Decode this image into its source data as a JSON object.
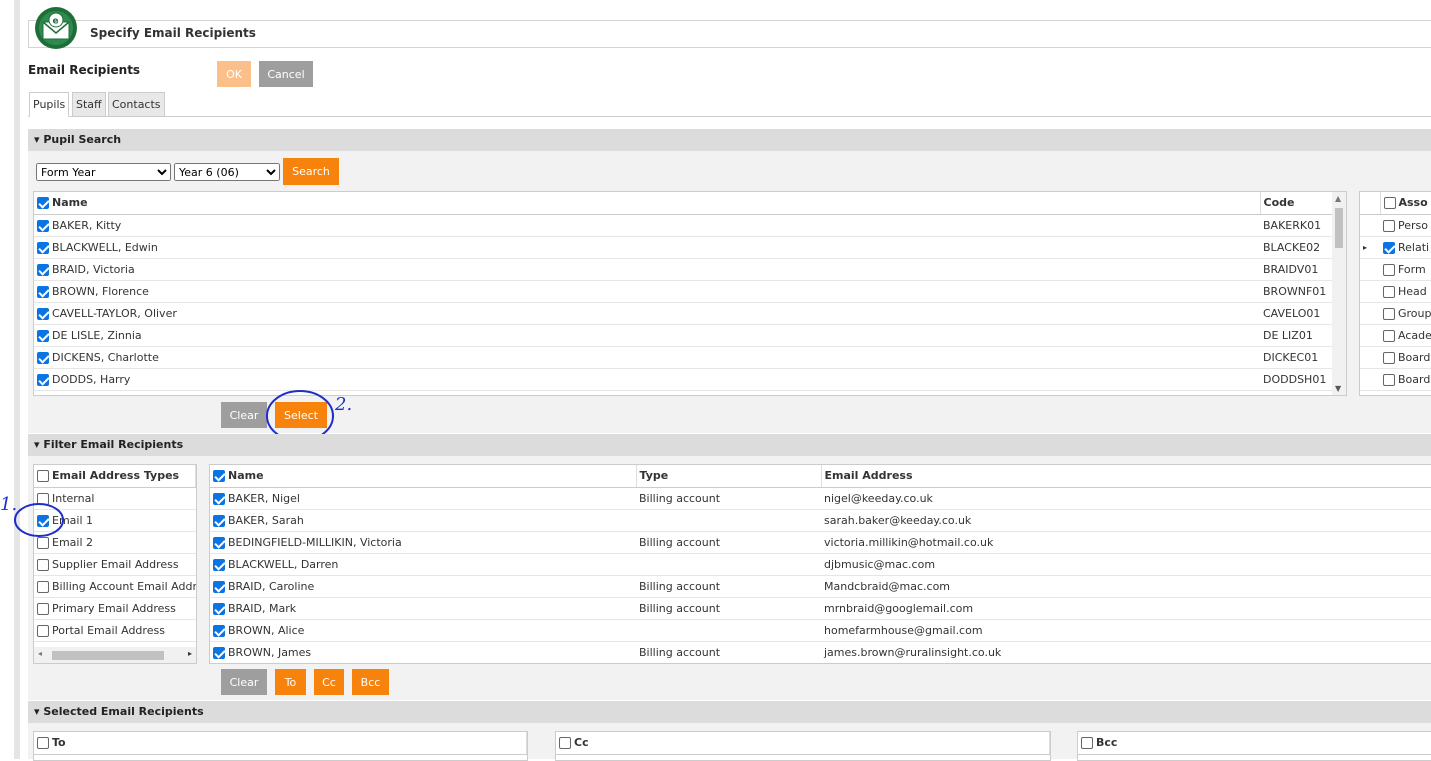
{
  "header": {
    "title": "Specify Email Recipients"
  },
  "recipients": {
    "heading": "Email Recipients",
    "ok_label": "OK",
    "cancel_label": "Cancel",
    "tabs": [
      "Pupils",
      "Staff",
      "Contacts"
    ]
  },
  "pupil_search": {
    "title": "Pupil Search",
    "filter_type": "Form Year",
    "filter_value": "Year 6 (06)",
    "search_label": "Search",
    "columns": {
      "name": "Name",
      "code": "Code"
    },
    "rows": [
      {
        "name": "BAKER, Kitty",
        "code": "BAKERK01"
      },
      {
        "name": "BLACKWELL, Edwin",
        "code": "BLACKE02"
      },
      {
        "name": "BRAID, Victoria",
        "code": "BRAIDV01"
      },
      {
        "name": "BROWN, Florence",
        "code": "BROWNF01"
      },
      {
        "name": "CAVELL-TAYLOR, Oliver",
        "code": "CAVELO01"
      },
      {
        "name": "DE LISLE, Zinnia",
        "code": "DE LIZ01"
      },
      {
        "name": "DICKENS, Charlotte",
        "code": "DICKEC01"
      },
      {
        "name": "DODDS, Harry",
        "code": "DODDSH01"
      }
    ],
    "assoc_header": "Asso",
    "assoc_rows": [
      "Perso",
      "Relati",
      "Form",
      "Head",
      "Group",
      "Acade",
      "Board",
      "Board"
    ],
    "clear_label": "Clear",
    "select_label": "Select"
  },
  "filter": {
    "title": "Filter Email Recipients",
    "types_header": "Email Address Types",
    "types": [
      {
        "label": "Internal",
        "checked": false
      },
      {
        "label": "Email 1",
        "checked": true
      },
      {
        "label": "Email 2",
        "checked": false
      },
      {
        "label": "Supplier Email Address",
        "checked": false
      },
      {
        "label": "Billing Account Email Addr",
        "checked": false
      },
      {
        "label": "Primary Email Address",
        "checked": false
      },
      {
        "label": "Portal Email Address",
        "checked": false
      }
    ],
    "columns": {
      "name": "Name",
      "type": "Type",
      "email": "Email Address"
    },
    "rows": [
      {
        "name": "BAKER, Nigel",
        "type": "Billing account",
        "email": "nigel@keeday.co.uk"
      },
      {
        "name": "BAKER, Sarah",
        "type": "",
        "email": "sarah.baker@keeday.co.uk"
      },
      {
        "name": "BEDINGFIELD-MILLIKIN, Victoria",
        "type": "Billing account",
        "email": "victoria.millikin@hotmail.co.uk"
      },
      {
        "name": "BLACKWELL, Darren",
        "type": "",
        "email": "djbmusic@mac.com"
      },
      {
        "name": "BRAID, Caroline",
        "type": "Billing account",
        "email": "Mandcbraid@mac.com"
      },
      {
        "name": "BRAID, Mark",
        "type": "Billing account",
        "email": "mrnbraid@googlemail.com"
      },
      {
        "name": "BROWN, Alice",
        "type": "",
        "email": "homefarmhouse@gmail.com"
      },
      {
        "name": "BROWN, James",
        "type": "Billing account",
        "email": "james.brown@ruralinsight.co.uk"
      }
    ],
    "clear_label": "Clear",
    "to_label": "To",
    "cc_label": "Cc",
    "bcc_label": "Bcc"
  },
  "selected": {
    "title": "Selected Email Recipients",
    "to_header": "To",
    "cc_header": "Cc",
    "bcc_header": "Bcc"
  },
  "annotations": {
    "one": "1.",
    "two": "2."
  },
  "colors": {
    "accent": "#f7830d",
    "check": "#0a74e3",
    "annotation": "#1e2fc8"
  }
}
